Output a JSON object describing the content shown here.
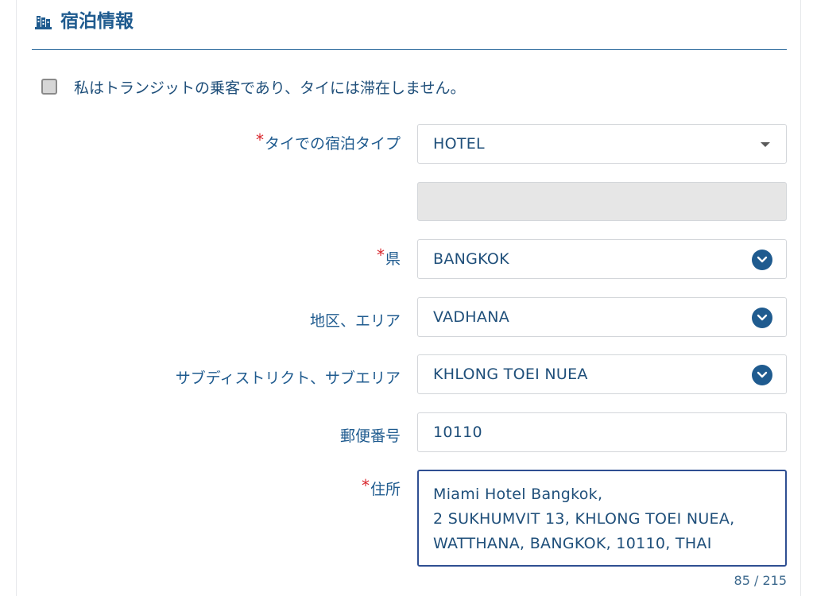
{
  "section": {
    "title": "宿泊情報",
    "icon": "hotel-icon"
  },
  "transit": {
    "label": "私はトランジットの乗客であり、タイには滞在しません。",
    "checked": false
  },
  "fields": {
    "accommodation_type": {
      "label": "タイでの宿泊タイプ",
      "required_mark": "*",
      "value": "HOTEL"
    },
    "province": {
      "label": "県",
      "required_mark": "*",
      "value": "BANGKOK"
    },
    "district": {
      "label": "地区、エリア",
      "value": "VADHANA"
    },
    "subdistrict": {
      "label": "サブディストリクト、サブエリア",
      "value": "KHLONG TOEI NUEA"
    },
    "postal_code": {
      "label": "郵便番号",
      "value": "10110"
    },
    "address": {
      "label": "住所",
      "required_mark": "*",
      "lines": [
        "Miami Hotel Bangkok,",
        "2 SUKHUMVIT 13, KHLONG TOEI NUEA,",
        "WATTHANA, BANGKOK, 10110, THAI"
      ],
      "char_count": "85",
      "separator": " / ",
      "char_limit": "215"
    }
  },
  "colors": {
    "primary": "#1f5b8f",
    "required": "#d8262c",
    "focus_border": "#2f4f92",
    "disabled_bg": "#e6e6e6"
  }
}
